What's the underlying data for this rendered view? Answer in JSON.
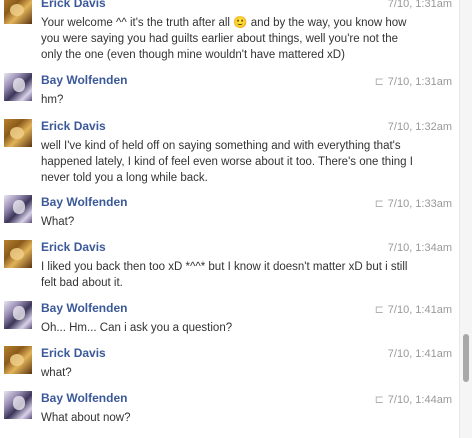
{
  "messages": [
    {
      "sender": "Erick Davis",
      "time": "7/10, 1:31am",
      "seen": false,
      "text": "Your welcome ^^ it's the truth after all 🙂 and by the way, you know how you were saying you had guilts earlier about things, well you're not the only the one (even though mine wouldn't have mattered xD)"
    },
    {
      "sender": "Bay Wolfenden",
      "time": "7/10, 1:31am",
      "seen": true,
      "text": "hm?"
    },
    {
      "sender": "Erick Davis",
      "time": "7/10, 1:32am",
      "seen": false,
      "text": "well I've kind of held off on saying something and with everything that's happened lately, I kind of feel even worse about it too. There's one thing I never told you a long while back."
    },
    {
      "sender": "Bay Wolfenden",
      "time": "7/10, 1:33am",
      "seen": true,
      "text": "What?"
    },
    {
      "sender": "Erick Davis",
      "time": "7/10, 1:34am",
      "seen": false,
      "text": "I liked you back then too xD *^^* but I know it doesn't matter xD but i still felt bad about it."
    },
    {
      "sender": "Bay Wolfenden",
      "time": "7/10, 1:41am",
      "seen": true,
      "text": "Oh... Hm... Can i ask you a question?"
    },
    {
      "sender": "Erick Davis",
      "time": "7/10, 1:41am",
      "seen": false,
      "text": "what?"
    },
    {
      "sender": "Bay Wolfenden",
      "time": "7/10, 1:44am",
      "seen": true,
      "text": "What about now?"
    }
  ],
  "icons": {
    "seen": "seen-check-icon",
    "avatar_erick": "avatar",
    "avatar_bay": "avatar"
  }
}
